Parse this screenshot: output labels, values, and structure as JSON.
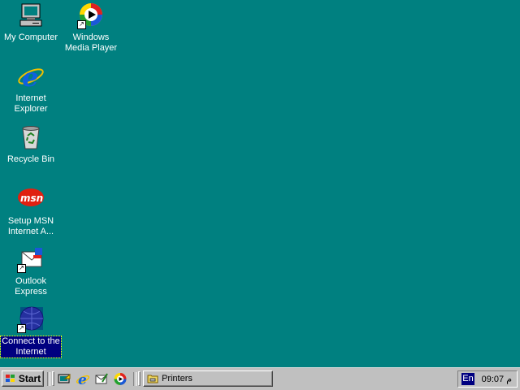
{
  "desktop": {
    "background_color": "#008080",
    "icons": [
      {
        "label": "My Computer",
        "icon": "my-computer-icon"
      },
      {
        "label": "Windows\nMedia Player",
        "icon": "media-player-icon"
      },
      {
        "label": "Internet\nExplorer",
        "icon": "internet-explorer-icon"
      },
      {
        "label": "Recycle Bin",
        "icon": "recycle-bin-icon"
      },
      {
        "label": "Setup MSN\nInternet A...",
        "icon": "msn-icon"
      },
      {
        "label": "Outlook\nExpress",
        "icon": "outlook-express-icon"
      },
      {
        "label": "Connect to the\nInternet",
        "icon": "connect-internet-icon",
        "selected": true
      }
    ]
  },
  "taskbar": {
    "start_label": "Start",
    "quick_launch": [
      "show-desktop-icon",
      "internet-explorer-icon",
      "outlook-express-icon",
      "media-player-icon"
    ],
    "task_button_label": "Printers",
    "language": "En",
    "clock": "09:07 م"
  }
}
